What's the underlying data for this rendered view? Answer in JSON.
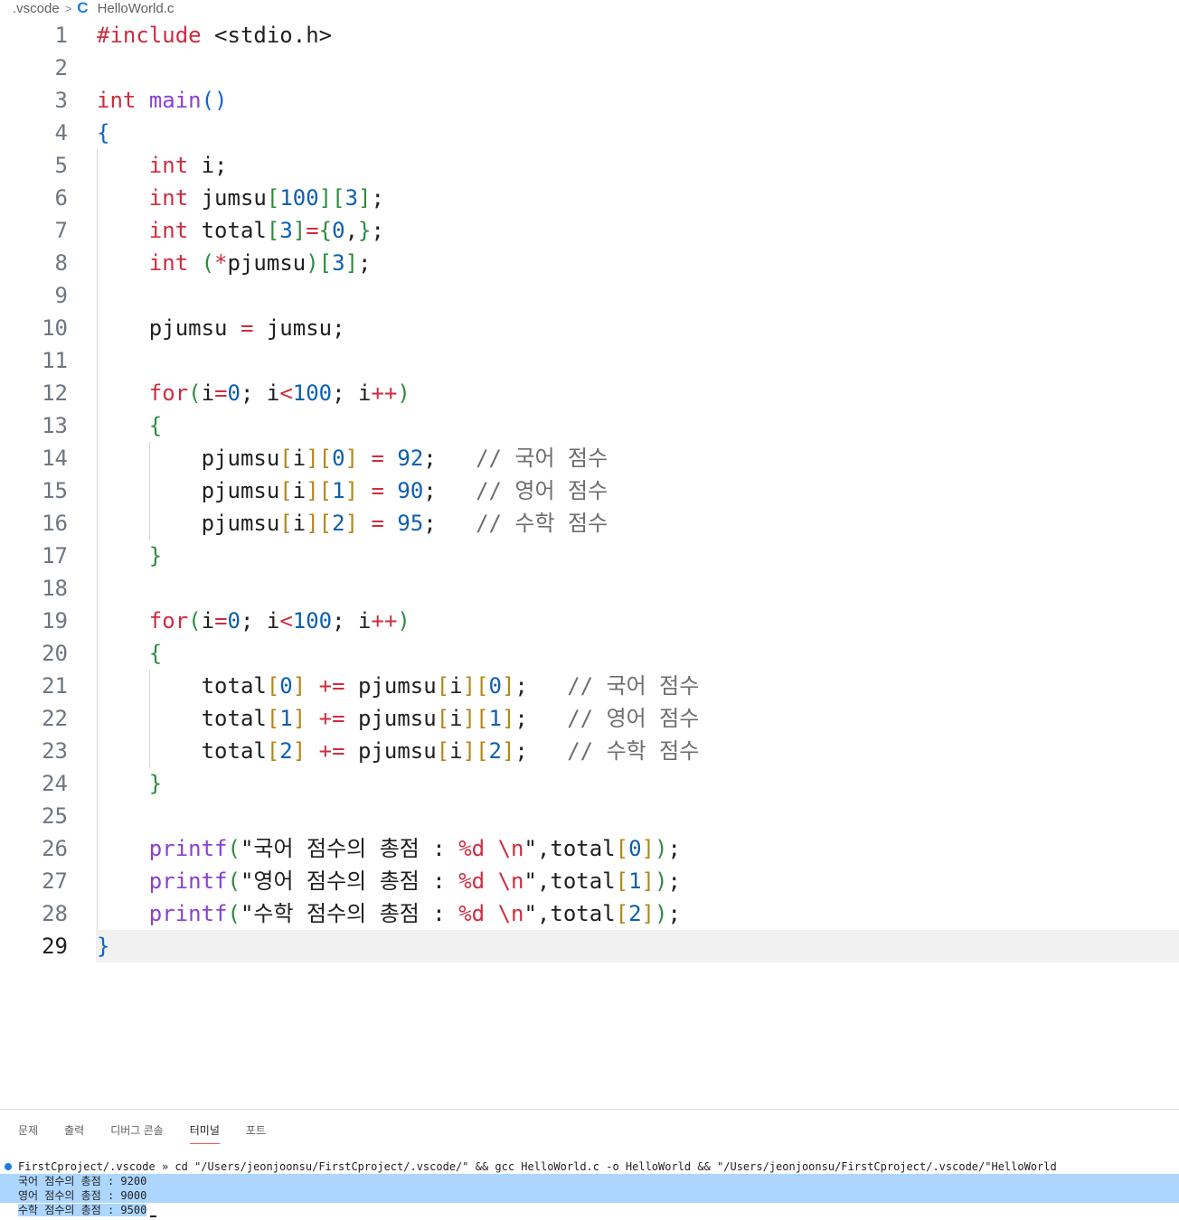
{
  "breadcrumb": {
    "folder": ".vscode",
    "file": "HelloWorld.c",
    "file_icon": "c-language-icon"
  },
  "editor": {
    "active_line": "29",
    "line_numbers": [
      "1",
      "2",
      "3",
      "4",
      "5",
      "6",
      "7",
      "8",
      "9",
      "10",
      "11",
      "12",
      "13",
      "14",
      "15",
      "16",
      "17",
      "18",
      "19",
      "20",
      "21",
      "22",
      "23",
      "24",
      "25",
      "26",
      "27",
      "28",
      "29"
    ]
  },
  "code": {
    "l1": {
      "a": "#include",
      "b": " <stdio.h>"
    },
    "l3": {
      "a": "int",
      "b": "main",
      "c": "()"
    },
    "l4": {
      "a": "{"
    },
    "l5": {
      "a": "int",
      "b": " i;"
    },
    "l6": {
      "a": "int",
      "b": " jumsu",
      "c": "[",
      "d": "100",
      "e": "]",
      "f": "[",
      "g": "3",
      "h": "]",
      "i": ";"
    },
    "l7": {
      "a": "int",
      "b": " total",
      "c": "[",
      "d": "3",
      "e": "]",
      "f": "=",
      "g": "{",
      "h": "0",
      "i": ",",
      "j": "}",
      "k": ";"
    },
    "l8": {
      "a": "int",
      "b": "(",
      "c": "*",
      "d": "pjumsu",
      "e": ")",
      "f": "[",
      "g": "3",
      "h": "]",
      "i": ";"
    },
    "l10": {
      "a": "pjumsu ",
      "b": "=",
      "c": " jumsu;"
    },
    "l12": {
      "a": "for",
      "b": "(",
      "c": "i",
      "d": "=",
      "e": "0",
      "f": "; i",
      "g": "<",
      "h": "100",
      "i": "; i",
      "j": "++",
      "k": ")"
    },
    "l13": {
      "a": "{"
    },
    "l14": {
      "a": "pjumsu",
      "b": "[",
      "c": "i",
      "d": "]",
      "e": "[",
      "f": "0",
      "g": "]",
      "h": " = ",
      "i": "92",
      "j": ";   ",
      "k": "// 국어 점수"
    },
    "l15": {
      "a": "pjumsu",
      "b": "[",
      "c": "i",
      "d": "]",
      "e": "[",
      "f": "1",
      "g": "]",
      "h": " = ",
      "i": "90",
      "j": ";   ",
      "k": "// 영어 점수"
    },
    "l16": {
      "a": "pjumsu",
      "b": "[",
      "c": "i",
      "d": "]",
      "e": "[",
      "f": "2",
      "g": "]",
      "h": " = ",
      "i": "95",
      "j": ";   ",
      "k": "// 수학 점수"
    },
    "l17": {
      "a": "}"
    },
    "l19": {
      "a": "for",
      "b": "(",
      "c": "i",
      "d": "=",
      "e": "0",
      "f": "; i",
      "g": "<",
      "h": "100",
      "i": "; i",
      "j": "++",
      "k": ")"
    },
    "l20": {
      "a": "{"
    },
    "l21": {
      "a": "total",
      "b": "[",
      "c": "0",
      "d": "]",
      "e": " += ",
      "f": "pjumsu",
      "g": "[",
      "h": "i",
      "i": "]",
      "j": "[",
      "k": "0",
      "l": "]",
      "m": ";   ",
      "n": "// 국어 점수"
    },
    "l22": {
      "a": "total",
      "b": "[",
      "c": "1",
      "d": "]",
      "e": " += ",
      "f": "pjumsu",
      "g": "[",
      "h": "i",
      "i": "]",
      "j": "[",
      "k": "1",
      "l": "]",
      "m": ";   ",
      "n": "// 영어 점수"
    },
    "l23": {
      "a": "total",
      "b": "[",
      "c": "2",
      "d": "]",
      "e": " += ",
      "f": "pjumsu",
      "g": "[",
      "h": "i",
      "i": "]",
      "j": "[",
      "k": "2",
      "l": "]",
      "m": ";   ",
      "n": "// 수학 점수"
    },
    "l24": {
      "a": "}"
    },
    "l26": {
      "a": "printf",
      "b": "(",
      "c": "\"국어 점수의 총점 : ",
      "d": "%d",
      "e": " ",
      "f": "\\n",
      "g": "\",total",
      "h": "[",
      "i": "0",
      "j": "]",
      "k": ")",
      "l": ";"
    },
    "l27": {
      "a": "printf",
      "b": "(",
      "c": "\"영어 점수의 총점 : ",
      "d": "%d",
      "e": " ",
      "f": "\\n",
      "g": "\",total",
      "h": "[",
      "i": "1",
      "j": "]",
      "k": ")",
      "l": ";"
    },
    "l28": {
      "a": "printf",
      "b": "(",
      "c": "\"수학 점수의 총점 : ",
      "d": "%d",
      "e": " ",
      "f": "\\n",
      "g": "\",total",
      "h": "[",
      "i": "2",
      "j": "]",
      "k": ")",
      "l": ";"
    },
    "l29": {
      "a": "}"
    }
  },
  "panel": {
    "tabs": [
      "문제",
      "출력",
      "디버그 콘솔",
      "터미널",
      "포트"
    ],
    "active_tab": "터미널"
  },
  "terminal": {
    "command": "FirstCproject/.vscode » cd \"/Users/jeonjoonsu/FirstCproject/.vscode/\" && gcc HelloWorld.c -o HelloWorld && \"/Users/jeonjoonsu/FirstCproject/.vscode/\"HelloWorld",
    "output": [
      "국어 점수의 총점 : 9200",
      "영어 점수의 총점 : 9000",
      "수학 점수의 총점 : 9500"
    ]
  },
  "colors": {
    "keyword": "#cd2d3f",
    "function": "#8a3fd6",
    "number": "#0b5fb0",
    "comment": "#6e6e6e",
    "selection": "#add6ff",
    "accent": "#1d7ddc"
  }
}
